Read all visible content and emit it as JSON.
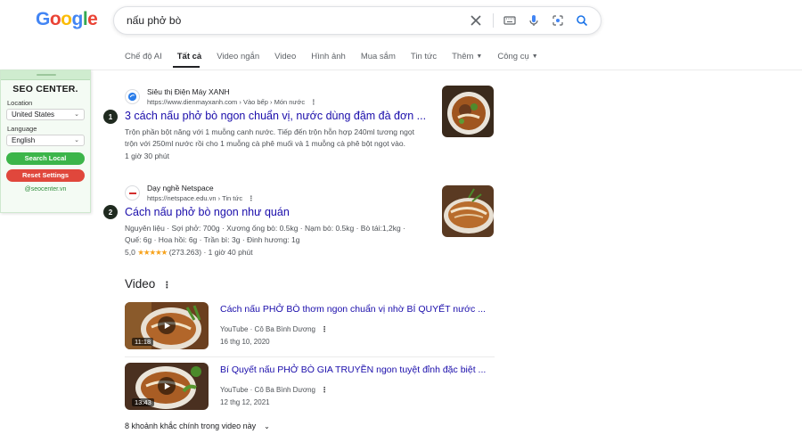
{
  "logo": {
    "g1": "G",
    "o1": "o",
    "o2": "o",
    "g2": "g",
    "l": "l",
    "e": "e"
  },
  "search": {
    "query": "nấu phở bò"
  },
  "tabs": [
    {
      "label": "Chế độ AI"
    },
    {
      "label": "Tất cả"
    },
    {
      "label": "Video ngắn"
    },
    {
      "label": "Video"
    },
    {
      "label": "Hình ảnh"
    },
    {
      "label": "Mua sắm"
    },
    {
      "label": "Tin tức"
    },
    {
      "label": "Thêm"
    },
    {
      "label": "Công cụ"
    }
  ],
  "seo_panel": {
    "brand": "SEO CENTER.",
    "location_label": "Location",
    "location_value": "United States",
    "language_label": "Language",
    "language_value": "English",
    "search_button": "Search Local",
    "reset_button": "Reset Settings",
    "footer": "@seocenter.vn"
  },
  "results": [
    {
      "rank": "1",
      "site": "Siêu thị Điện Máy XANH",
      "url": "https://www.dienmayxanh.com › Vào bếp › Món nước",
      "title": "3 cách nấu phở bò ngon chuẩn vị, nước dùng đậm đà đơn ...",
      "snippet1": "Trộn phần bột năng với 1 muỗng canh nước. Tiếp đến trộn hỗn hợp 240ml tương ngọt",
      "snippet2": "trộn với 250ml nước rồi cho 1 muỗng cà phê muối và 1 muỗng cà phê bột ngọt vào.",
      "meta": "1 giờ 30 phút"
    },
    {
      "rank": "2",
      "site": "Dạy nghề Netspace",
      "url": "https://netspace.edu.vn › Tin tức",
      "title": "Cách nấu phở bò ngon như quán",
      "snippet1": "Nguyên liệu · Sợi phở: 700g · Xương ống bò: 0.5kg · Nạm bò: 0.5kg · Bò tái:1,2kg ·",
      "snippet2": "Quế: 6g · Hoa hồi: 6g · Trần bì: 3g · Đinh hương: 1g",
      "rating": "5,0",
      "stars": "★★★★★",
      "reviews": "(273.263)",
      "meta": "1 giờ 40 phút"
    }
  ],
  "video_section": {
    "heading": "Video",
    "items": [
      {
        "title": "Cách nấu PHỞ BÒ thơm ngon chuẩn vị nhờ BÍ QUYẾT nước ...",
        "source": "YouTube · Cô Ba Bình Dương",
        "date": "16 thg 10, 2020",
        "duration": "11:18"
      },
      {
        "title": "Bí Quyết nấu PHỞ BÒ GIA TRUYỀN ngon tuyệt đỉnh đặc biệt ...",
        "source": "YouTube · Cô Ba Bình Dương",
        "date": "12 thg 12, 2021",
        "duration": "13:43"
      }
    ],
    "moments": "8 khoảnh khắc chính trong video này"
  }
}
